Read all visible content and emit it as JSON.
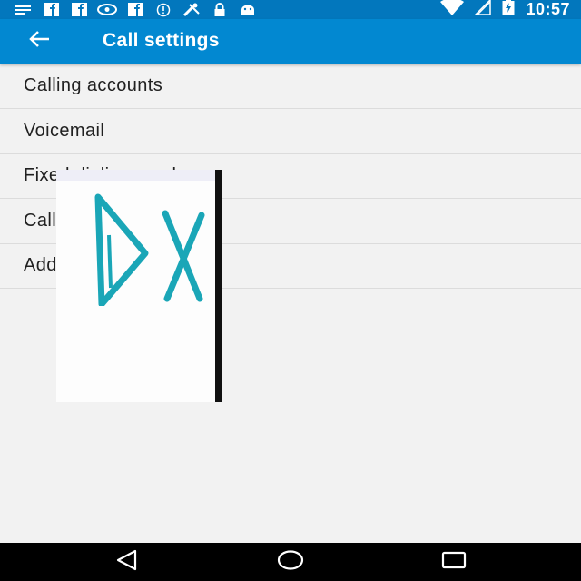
{
  "status_bar": {
    "time": "10:57",
    "left_icons": [
      "notification-icon",
      "facebook-icon",
      "facebook-icon",
      "eye-icon",
      "facebook-icon",
      "info-icon",
      "tools-icon",
      "lock-icon",
      "android-icon"
    ],
    "right_icons": [
      "wifi-icon",
      "signal-icon",
      "battery-charging-icon"
    ]
  },
  "toolbar": {
    "title": "Call settings",
    "back_icon": "back-arrow-icon"
  },
  "settings_list": {
    "items": [
      {
        "label": "Calling accounts"
      },
      {
        "label": "Voicemail"
      },
      {
        "label": "Fixed dialing numbers"
      },
      {
        "label": "Call barring"
      },
      {
        "label": "Additional settings"
      }
    ]
  },
  "overlay": {
    "icon": "play-close-icon"
  },
  "nav_bar": {
    "icons": [
      "back-triangle-icon",
      "home-circle-icon",
      "recents-square-icon"
    ]
  },
  "colors": {
    "status_bar": "#0277bd",
    "toolbar": "#0288d1",
    "background": "#f2f2f2",
    "overlay_icon": "#1aa6b7"
  }
}
